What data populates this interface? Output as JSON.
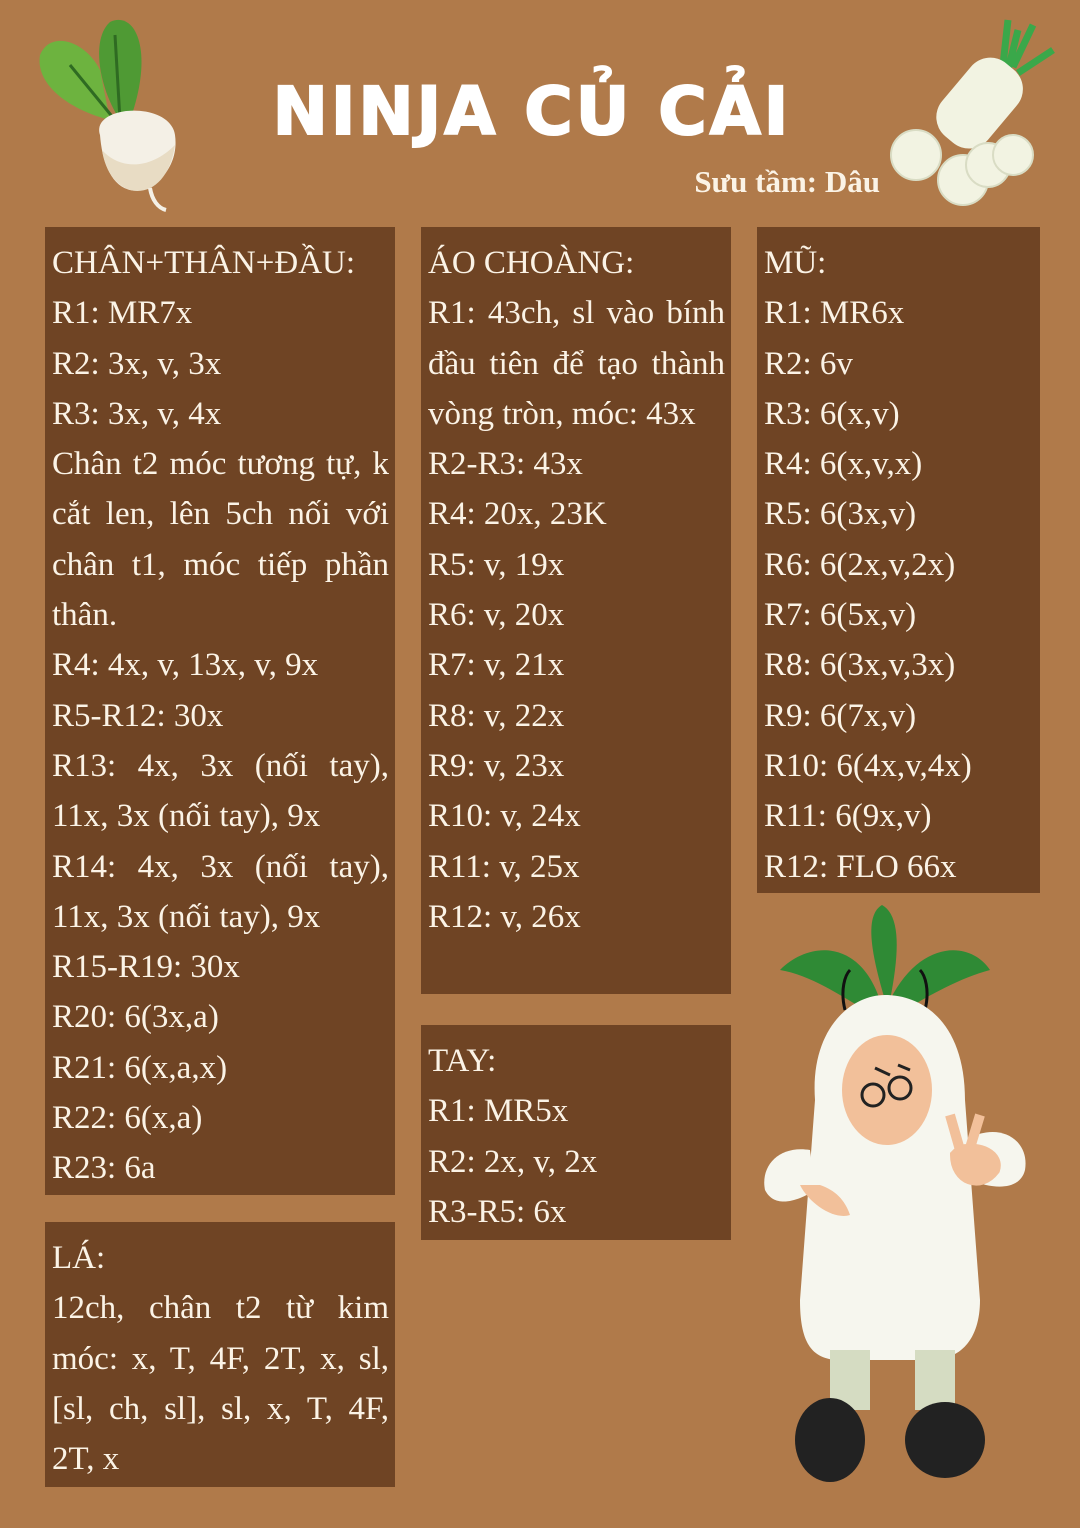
{
  "title": "NINJA CỦ CẢI",
  "credit": "Sưu tầm: Dâu",
  "colors": {
    "background": "#b07a4a",
    "panel": "#6f4424",
    "text": "#fbf3e6",
    "leaf": "#3a8a2e"
  },
  "sections": {
    "body": {
      "heading": "CHÂN+THÂN+ĐẦU:",
      "lines": [
        "R1: MR7x",
        "R2: 3x, v, 3x",
        "R3: 3x, v, 4x"
      ],
      "note": "Chân t2 móc tương tự, k cắt len, lên 5ch nối với chân t1, móc tiếp phần thân.",
      "lines2": [
        "R4: 4x, v, 13x, v, 9x",
        "R5-R12: 30x"
      ],
      "r13": "R13: 4x, 3x (nối tay), 11x, 3x (nối tay), 9x",
      "r14": "R14: 4x, 3x (nối tay), 11x, 3x (nối tay), 9x",
      "lines3": [
        "R15-R19: 30x",
        "R20: 6(3x,a)",
        "R21: 6(x,a,x)",
        "R22: 6(x,a)",
        "R23: 6a"
      ]
    },
    "leaf": {
      "heading": "LÁ:",
      "text": "12ch, chân t2 từ kim móc: x, T, 4F, 2T, x, sl, [sl, ch, sl], sl, x, T, 4F, 2T, x"
    },
    "cape": {
      "heading": "ÁO CHOÀNG:",
      "r1": "R1: 43ch, sl vào bính đầu tiên để tạo thành vòng tròn, móc: 43x",
      "lines": [
        "R2-R3: 43x",
        "R4: 20x, 23K",
        "R5: v, 19x",
        "R6: v, 20x",
        "R7: v, 21x",
        "R8: v, 22x",
        "R9: v, 23x",
        "R10: v, 24x",
        "R11: v, 25x",
        "R12: v, 26x"
      ]
    },
    "arm": {
      "heading": "TAY:",
      "lines": [
        "R1: MR5x",
        "R2: 2x, v, 2x",
        "R3-R5: 6x"
      ]
    },
    "hat": {
      "heading": "MŨ:",
      "lines": [
        "R1: MR6x",
        "R2: 6v",
        "R3: 6(x,v)",
        "R4: 6(x,v,x)",
        "R5: 6(3x,v)",
        "R6: 6(2x,v,2x)",
        "R7: 6(5x,v)",
        "R8: 6(3x,v,3x)",
        "R9: 6(7x,v)",
        "R10: 6(4x,v,4x)",
        "R11: 6(9x,v)",
        "R12: FLO 66x"
      ]
    }
  }
}
